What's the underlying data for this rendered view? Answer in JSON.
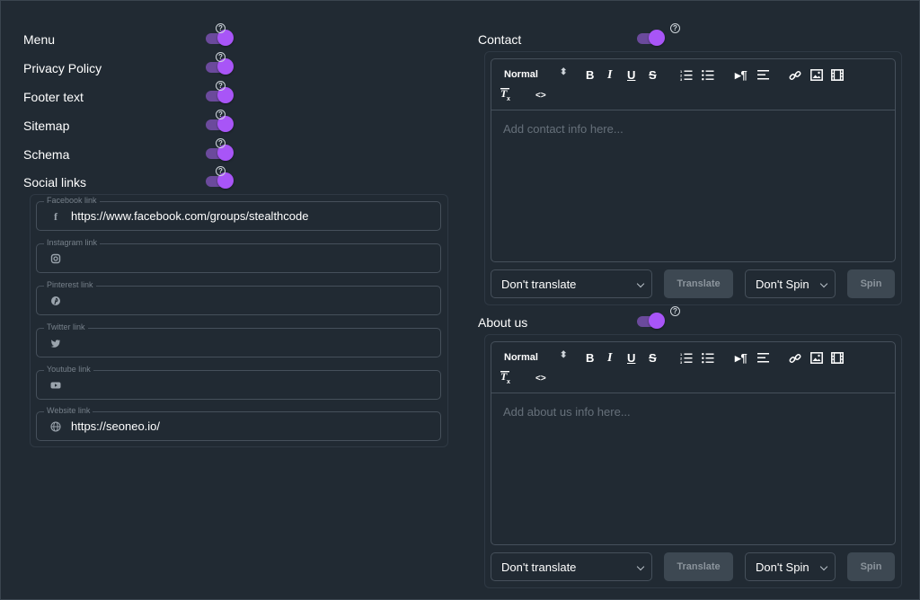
{
  "left_toggles": [
    {
      "label": "Menu",
      "on": true
    },
    {
      "label": "Privacy Policy",
      "on": true
    },
    {
      "label": "Footer text",
      "on": true
    },
    {
      "label": "Sitemap",
      "on": true
    },
    {
      "label": "Schema",
      "on": true
    },
    {
      "label": "Social links",
      "on": true
    }
  ],
  "help_glyph": "?",
  "social_fields": [
    {
      "legend": "Facebook link",
      "icon": "facebook-icon",
      "value": "https://www.facebook.com/groups/stealthcode"
    },
    {
      "legend": "Instagram link",
      "icon": "instagram-icon",
      "value": ""
    },
    {
      "legend": "Pinterest link",
      "icon": "pinterest-icon",
      "value": ""
    },
    {
      "legend": "Twitter link",
      "icon": "twitter-icon",
      "value": ""
    },
    {
      "legend": "Youtube link",
      "icon": "youtube-icon",
      "value": ""
    },
    {
      "legend": "Website link",
      "icon": "globe-icon",
      "value": "https://seoneo.io/"
    }
  ],
  "contact": {
    "label": "Contact",
    "on": true,
    "placeholder": "Add contact info here...",
    "translate_select": "Don't translate",
    "translate_button": "Translate",
    "spin_select": "Don't Spin",
    "spin_button": "Spin"
  },
  "about": {
    "label": "About us",
    "on": true,
    "placeholder": "Add about us info here...",
    "translate_select": "Don't translate",
    "translate_button": "Translate",
    "spin_select": "Don't Spin",
    "spin_button": "Spin"
  },
  "toolbar": {
    "format_select": "Normal",
    "bold": "B",
    "italic": "I",
    "underline": "U",
    "strike": "S",
    "rtl": "¶",
    "code": "<>"
  },
  "colors": {
    "background": "#212a33",
    "accent": "#a855f7",
    "toggle_track": "#6b4a9c"
  }
}
